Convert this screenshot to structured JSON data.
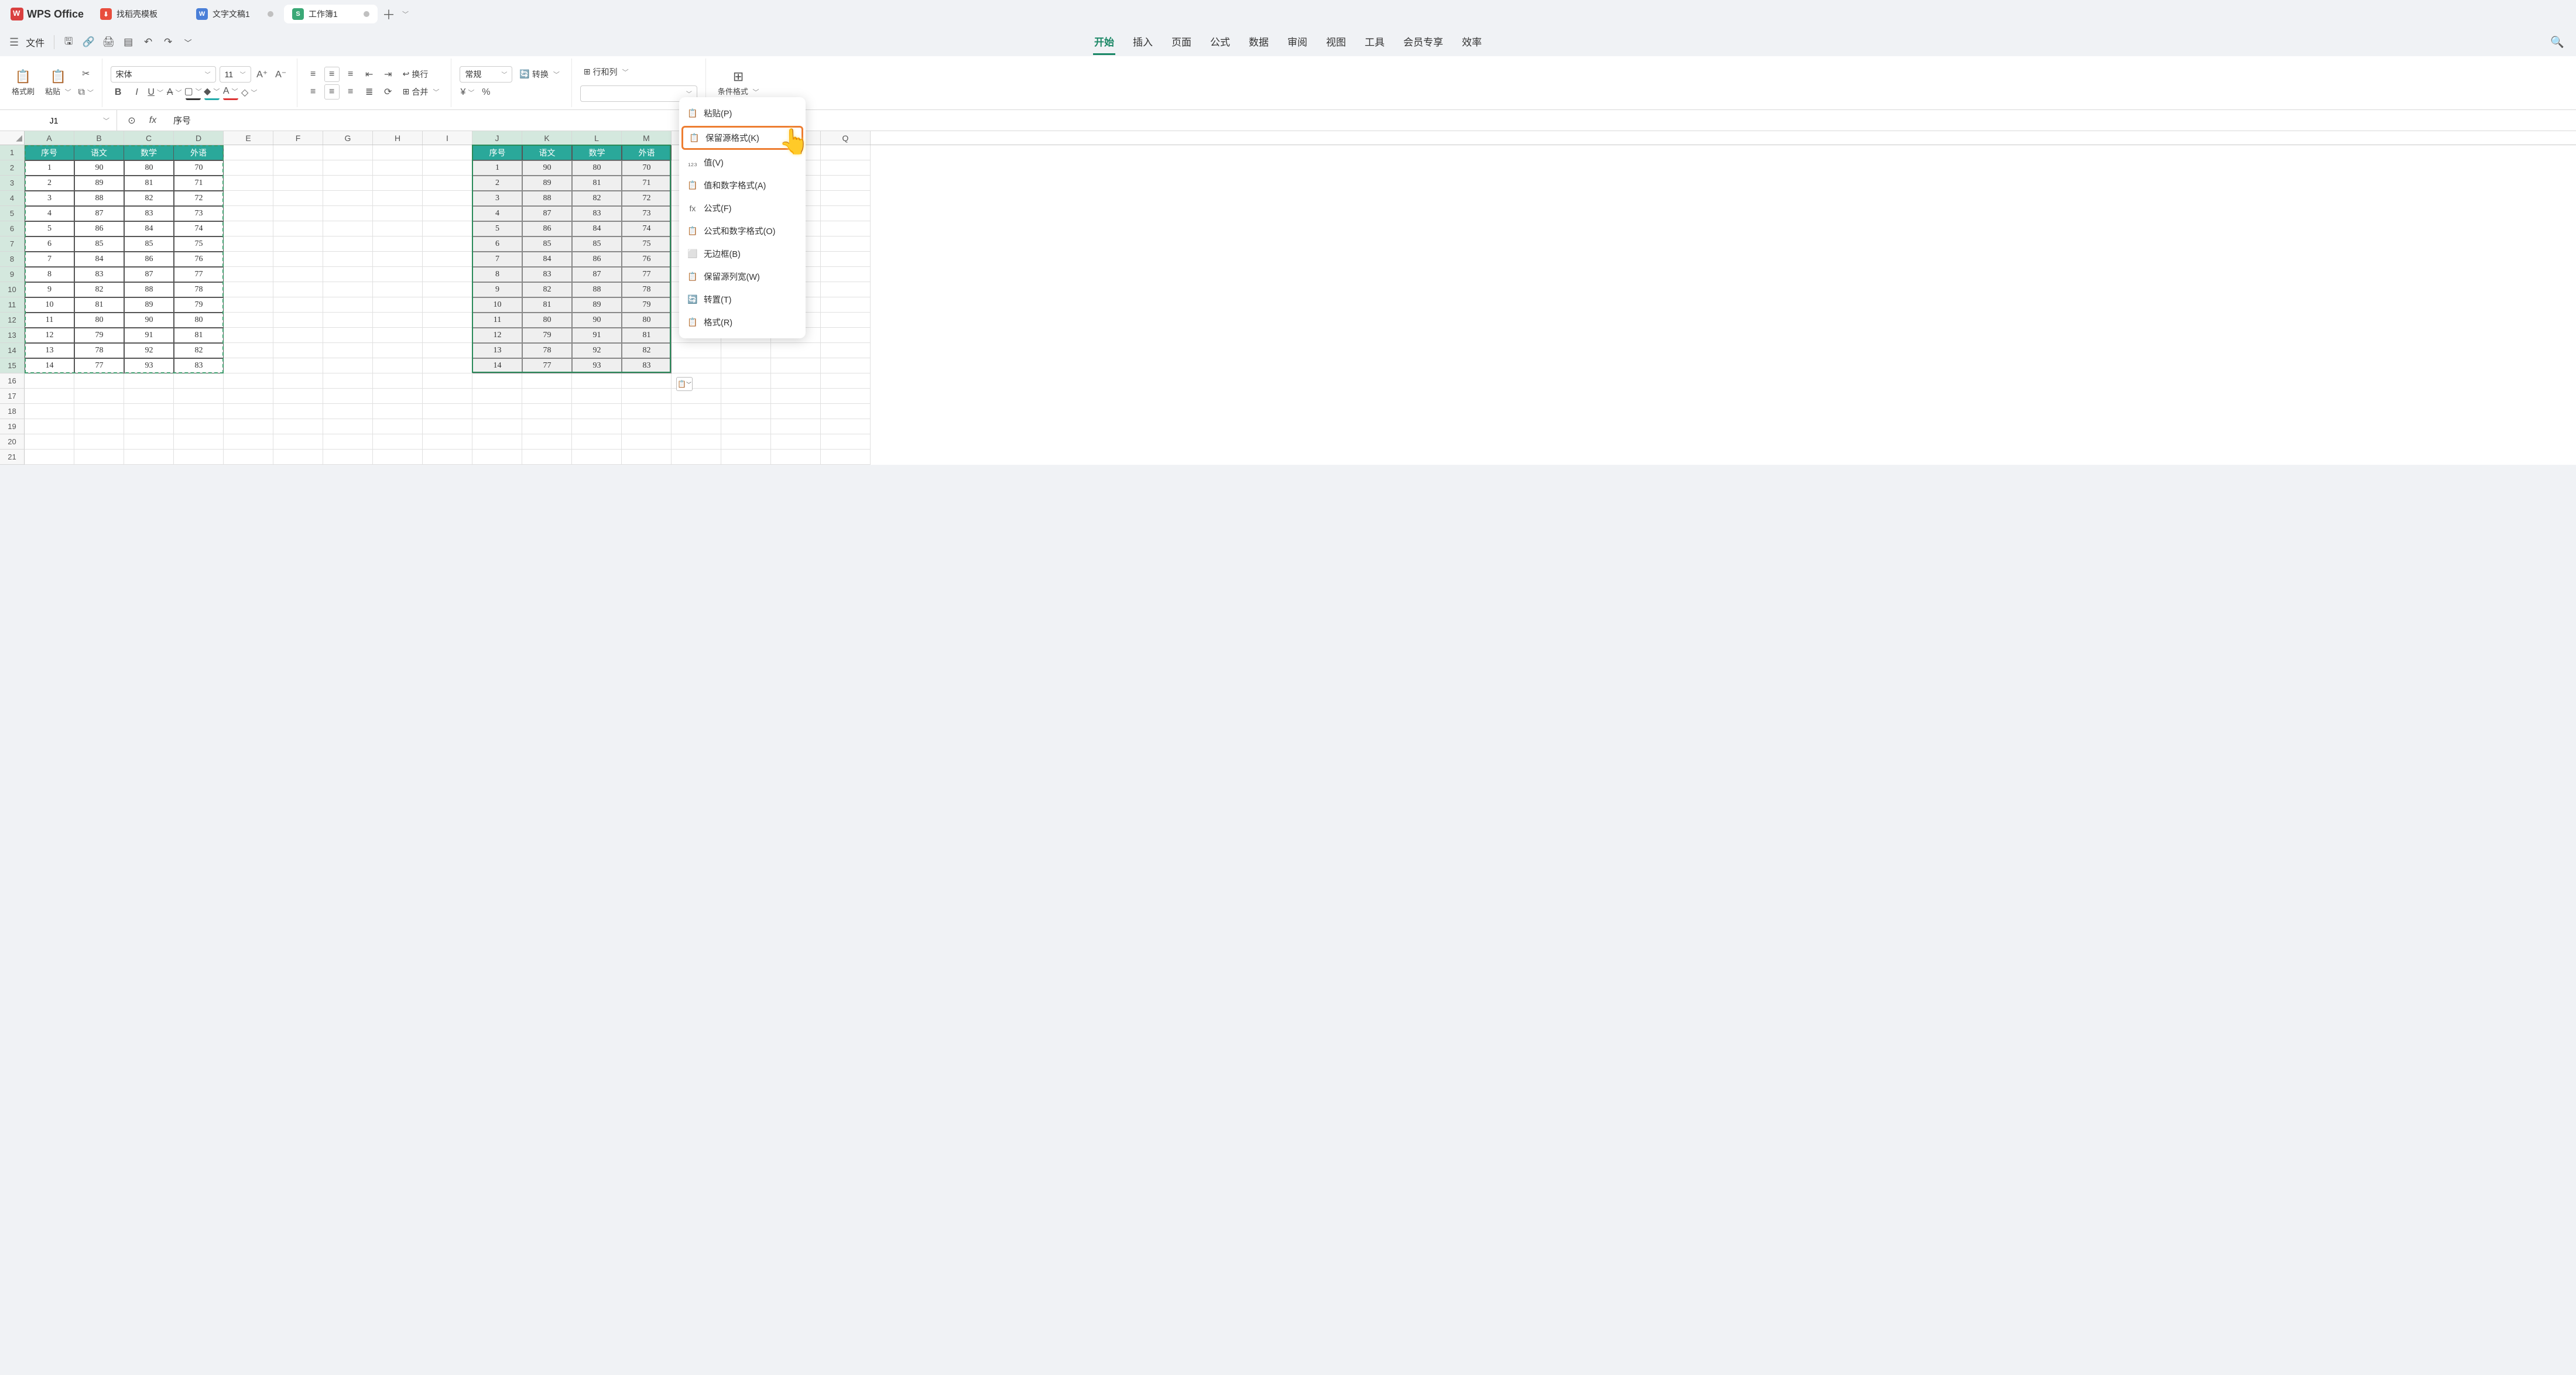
{
  "app": {
    "name": "WPS Office"
  },
  "tabs": [
    {
      "label": "找稻壳模板",
      "icon": "red",
      "glyph": "⬇"
    },
    {
      "label": "文字文稿1",
      "icon": "blue",
      "glyph": "W"
    },
    {
      "label": "工作簿1",
      "icon": "green",
      "glyph": "S",
      "active": true
    }
  ],
  "menu": {
    "file": "文件"
  },
  "ribbon_tabs": [
    "开始",
    "插入",
    "页面",
    "公式",
    "数据",
    "审阅",
    "视图",
    "工具",
    "会员专享",
    "效率"
  ],
  "ribbon_active": "开始",
  "ribbon": {
    "format_painter": "格式刷",
    "paste": "粘贴",
    "font_name": "宋体",
    "font_size": "11",
    "wrap": "换行",
    "merge": "合并",
    "number_format": "常规",
    "convert": "转换",
    "rowcol": "行和列",
    "cond_fmt": "条件格式"
  },
  "namebox": "J1",
  "formula": "序号",
  "columns": [
    "A",
    "B",
    "C",
    "D",
    "E",
    "F",
    "G",
    "H",
    "I",
    "J",
    "K",
    "L",
    "M",
    "N",
    "O",
    "P",
    "Q"
  ],
  "row_count": 21,
  "src_range": {
    "c0": 0,
    "c1": 3,
    "r0": 0,
    "r1": 14
  },
  "dst_range": {
    "c0": 9,
    "c1": 12,
    "r0": 0,
    "r1": 14
  },
  "headers": [
    "序号",
    "语文",
    "数学",
    "外语"
  ],
  "table": [
    [
      1,
      90,
      80,
      70
    ],
    [
      2,
      89,
      81,
      71
    ],
    [
      3,
      88,
      82,
      72
    ],
    [
      4,
      87,
      83,
      73
    ],
    [
      5,
      86,
      84,
      74
    ],
    [
      6,
      85,
      85,
      75
    ],
    [
      7,
      84,
      86,
      76
    ],
    [
      8,
      83,
      87,
      77
    ],
    [
      9,
      82,
      88,
      78
    ],
    [
      10,
      81,
      89,
      79
    ],
    [
      11,
      80,
      90,
      80
    ],
    [
      12,
      79,
      91,
      81
    ],
    [
      13,
      78,
      92,
      82
    ],
    [
      14,
      77,
      93,
      83
    ]
  ],
  "paste_menu": [
    {
      "id": "paste",
      "label": "粘贴(P)",
      "icon": "📋"
    },
    {
      "id": "keep-source",
      "label": "保留源格式(K)",
      "icon": "📋",
      "highlight": true
    },
    {
      "id": "values",
      "label": "值(V)",
      "icon": "₁₂₃"
    },
    {
      "id": "values-num",
      "label": "值和数字格式(A)",
      "icon": "📋"
    },
    {
      "id": "formulas",
      "label": "公式(F)",
      "icon": "fx"
    },
    {
      "id": "formulas-num",
      "label": "公式和数字格式(O)",
      "icon": "📋"
    },
    {
      "id": "no-border",
      "label": "无边框(B)",
      "icon": "⬜"
    },
    {
      "id": "col-width",
      "label": "保留源列宽(W)",
      "icon": "📋"
    },
    {
      "id": "transpose",
      "label": "转置(T)",
      "icon": "🔄"
    },
    {
      "id": "format",
      "label": "格式(R)",
      "icon": "📋"
    }
  ]
}
